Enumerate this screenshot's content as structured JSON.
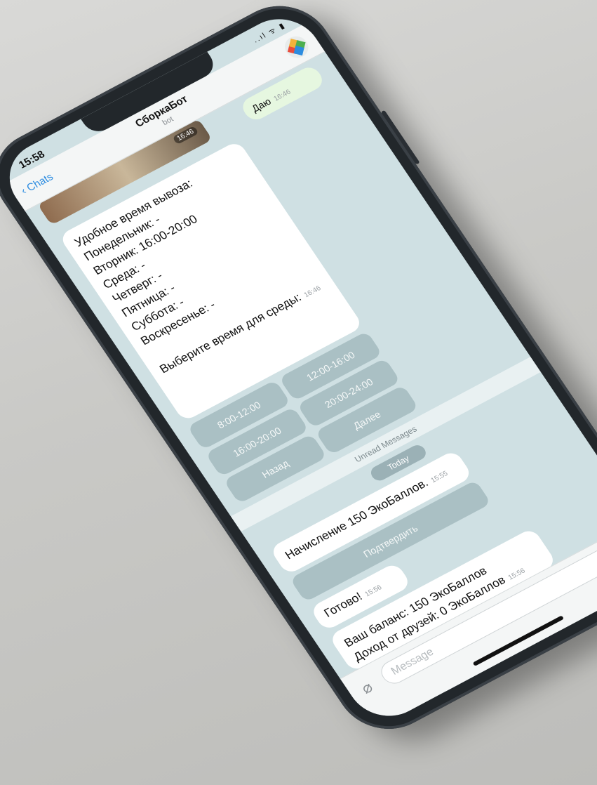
{
  "status": {
    "time": "15:58",
    "icons": "..ıl ᯤ ▮"
  },
  "nav": {
    "back_label": "Chats",
    "title": "СборкаБот",
    "subtitle": "bot"
  },
  "logo_colors": [
    "#e84b3c",
    "#f3b23a",
    "#4caf50",
    "#2c8ce0"
  ],
  "image_message": {
    "time": "16:46"
  },
  "outgoing": {
    "text": "Даю",
    "time": "16:46"
  },
  "schedule": {
    "text": "Удобное время вывоза:\n  Понедельник: -\n  Вторник: 16:00-20:00\n  Среда: -\n  Четверг: -\n  Пятница: -\n  Суббота: -\n  Воскресенье: -\n\nВыберите время для среды:",
    "time": "16:46"
  },
  "keyboard": {
    "buttons": [
      "8:00-12:00",
      "12:00-16:00",
      "16:00-20:00",
      "20:00-24:00",
      "Назад",
      "Далее"
    ]
  },
  "divider": {
    "label": "Unread Messages"
  },
  "date_pill": {
    "label": "Today"
  },
  "accrual": {
    "text": "Начисление 150 ЭкоБаллов.",
    "time": "15:55",
    "button": "Подтвердить"
  },
  "done": {
    "text": "Готово!",
    "time": "15:56"
  },
  "balance": {
    "text": "Ваш баланс: 150 ЭкоБаллов\nДоход от друзей: 0 ЭкоБаллов",
    "time": "15:56"
  },
  "input": {
    "placeholder": "Message"
  }
}
